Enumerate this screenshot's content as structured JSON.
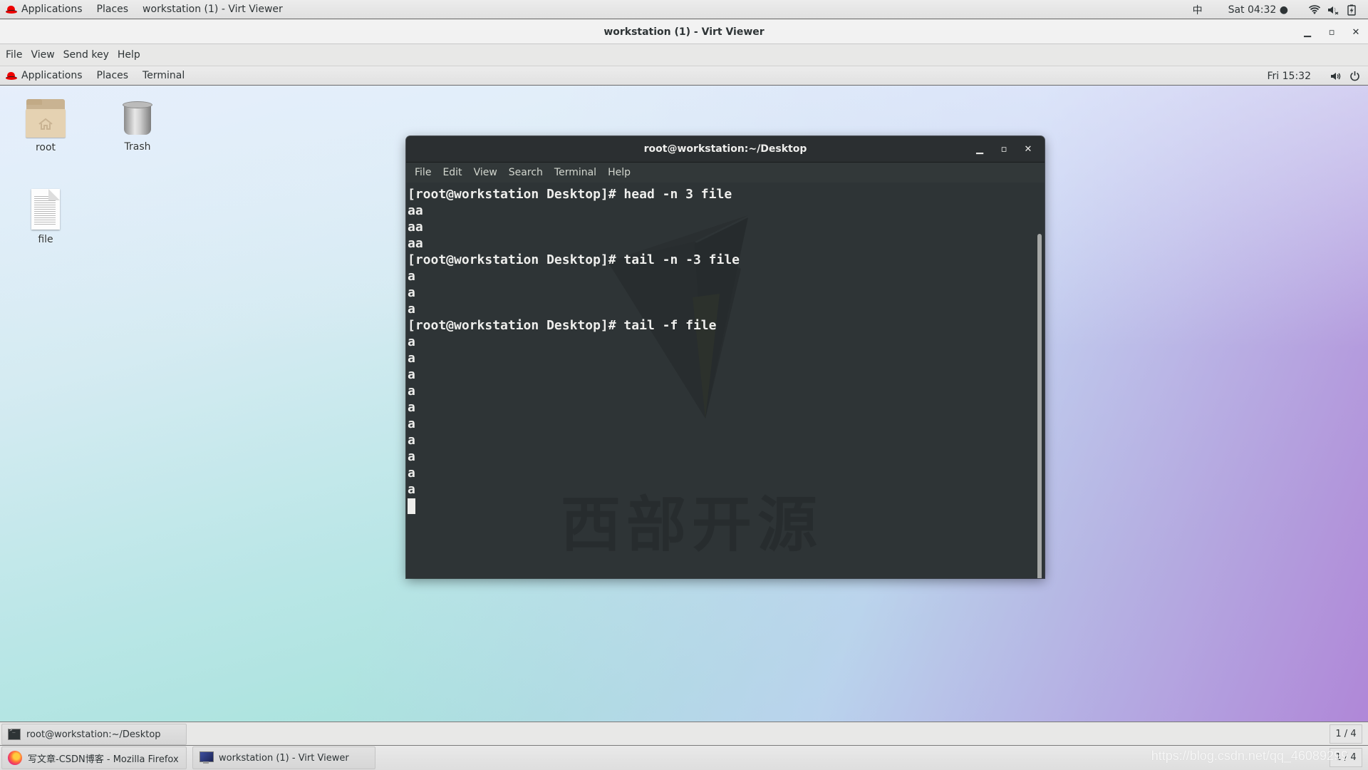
{
  "host_topbar": {
    "applications": "Applications",
    "places": "Places",
    "active_window": "workstation (1) - Virt Viewer",
    "input_method": "中",
    "clock": "Sat 04:32 ●",
    "icons": [
      "wifi-icon",
      "volume-muted-icon",
      "battery-charging-icon"
    ]
  },
  "virt_viewer": {
    "title": "workstation (1) - Virt Viewer",
    "controls": {
      "minimize": "▁",
      "maximize": "▫",
      "close": "✕"
    },
    "menu": [
      "File",
      "View",
      "Send key",
      "Help"
    ]
  },
  "guest_topbar": {
    "applications": "Applications",
    "places": "Places",
    "terminal": "Terminal",
    "clock": "Fri 15:32",
    "icons": [
      "volume-icon",
      "power-icon"
    ]
  },
  "desktop_icons": [
    {
      "label": "root",
      "icon": "home-folder-icon"
    },
    {
      "label": "Trash",
      "icon": "trash-icon"
    },
    {
      "label": "file",
      "icon": "text-file-icon"
    }
  ],
  "terminal": {
    "title": "root@workstation:~/Desktop",
    "menu": [
      "File",
      "Edit",
      "View",
      "Search",
      "Terminal",
      "Help"
    ],
    "lines": [
      "[root@workstation Desktop]# head -n 3 file",
      "aa",
      "aa",
      "aa",
      "[root@workstation Desktop]# tail -n -3 file",
      "a",
      "a",
      "a",
      "[root@workstation Desktop]# tail -f file",
      "a",
      "a",
      "a",
      "a",
      "a",
      "a",
      "a",
      "a",
      "a",
      "a"
    ],
    "watermark": "西部开源"
  },
  "guest_taskbar": {
    "items": [
      {
        "label": "root@workstation:~/Desktop",
        "icon": "terminal-icon"
      }
    ],
    "workspace": "1 / 4"
  },
  "host_taskbar": {
    "items": [
      {
        "label": "写文章-CSDN博客 - Mozilla Firefox",
        "icon": "firefox-icon"
      },
      {
        "label": "workstation (1) - Virt Viewer",
        "icon": "virt-viewer-icon"
      }
    ],
    "workspace": "1 / 4",
    "watermark": "https://blog.csdn.net/qq_46089299"
  }
}
